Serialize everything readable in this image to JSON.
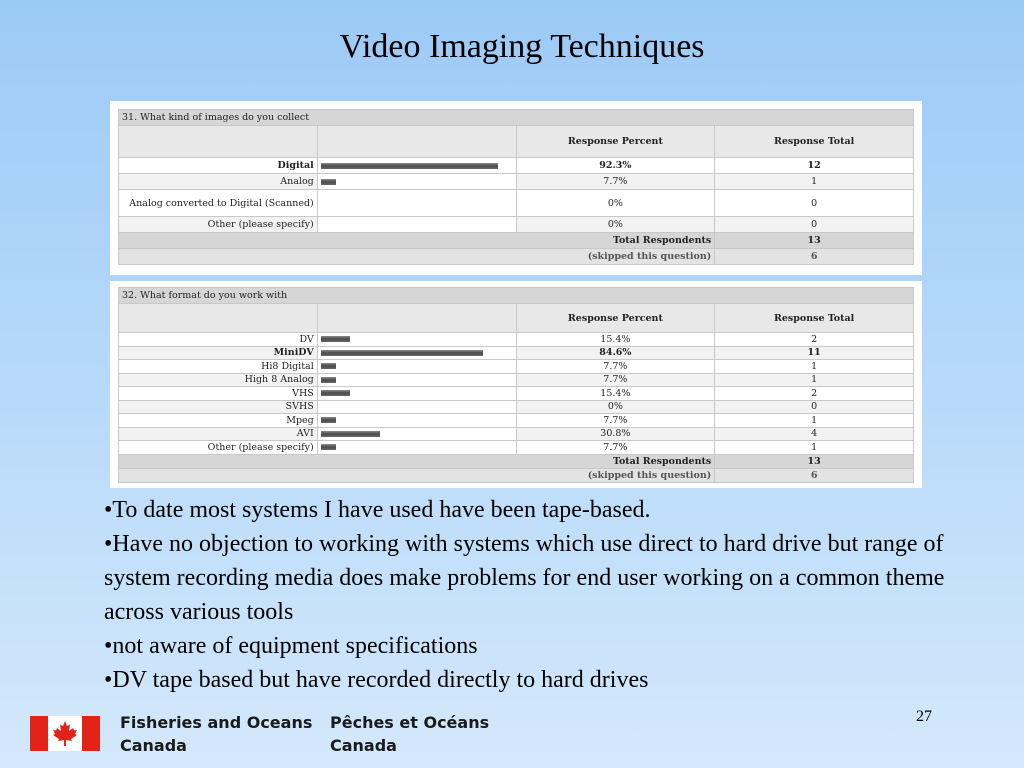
{
  "slide": {
    "title": "Video Imaging Techniques",
    "page_number": "27"
  },
  "survey1": {
    "question": "31. What kind of images do you collect",
    "col_percent": "Response Percent",
    "col_total": "Response Total",
    "rows": [
      {
        "label": "Digital",
        "percent": "92.3%",
        "total": "12",
        "fraction": 0.923,
        "bold": true
      },
      {
        "label": "Analog",
        "percent": "7.7%",
        "total": "1",
        "fraction": 0.077,
        "bold": false
      },
      {
        "label": "Analog converted to Digital (Scanned)",
        "percent": "0%",
        "total": "0",
        "fraction": 0,
        "bold": false
      },
      {
        "label": "Other (please specify)",
        "percent": "0%",
        "total": "0",
        "fraction": 0,
        "bold": false
      }
    ],
    "total_label": "Total Respondents",
    "total_value": "13",
    "skipped_label": "(skipped this question)",
    "skipped_value": "6"
  },
  "survey2": {
    "question": "32. What format do you work with",
    "col_percent": "Response Percent",
    "col_total": "Response Total",
    "rows": [
      {
        "label": "DV",
        "percent": "15.4%",
        "total": "2",
        "fraction": 0.154,
        "bold": false
      },
      {
        "label": "MiniDV",
        "percent": "84.6%",
        "total": "11",
        "fraction": 0.846,
        "bold": true
      },
      {
        "label": "Hi8 Digital",
        "percent": "7.7%",
        "total": "1",
        "fraction": 0.077,
        "bold": false
      },
      {
        "label": "High 8 Analog",
        "percent": "7.7%",
        "total": "1",
        "fraction": 0.077,
        "bold": false
      },
      {
        "label": "VHS",
        "percent": "15.4%",
        "total": "2",
        "fraction": 0.154,
        "bold": false
      },
      {
        "label": "SVHS",
        "percent": "0%",
        "total": "0",
        "fraction": 0,
        "bold": false
      },
      {
        "label": "Mpeg",
        "percent": "7.7%",
        "total": "1",
        "fraction": 0.077,
        "bold": false
      },
      {
        "label": "AVI",
        "percent": "30.8%",
        "total": "4",
        "fraction": 0.308,
        "bold": false
      },
      {
        "label": "Other (please specify)",
        "percent": "7.7%",
        "total": "1",
        "fraction": 0.077,
        "bold": false
      }
    ],
    "total_label": "Total Respondents",
    "total_value": "13",
    "skipped_label": "(skipped this question)",
    "skipped_value": "6"
  },
  "bullets": [
    "•To date most systems I have used have been tape-based.",
    "•Have no objection to working with systems which use direct to hard drive but range of system recording media does make problems for end user working on a common theme across various tools",
    "•not aware of equipment specifications",
    "•DV tape based but have recorded directly to hard drives"
  ],
  "footer": {
    "org_en_line1": "Fisheries and Oceans",
    "org_en_line2": "Canada",
    "org_fr_line1": "Pêches et Océans",
    "org_fr_line2": "Canada",
    "flag_icon": "canada-flag-icon",
    "flag_red": "#e2231a"
  }
}
